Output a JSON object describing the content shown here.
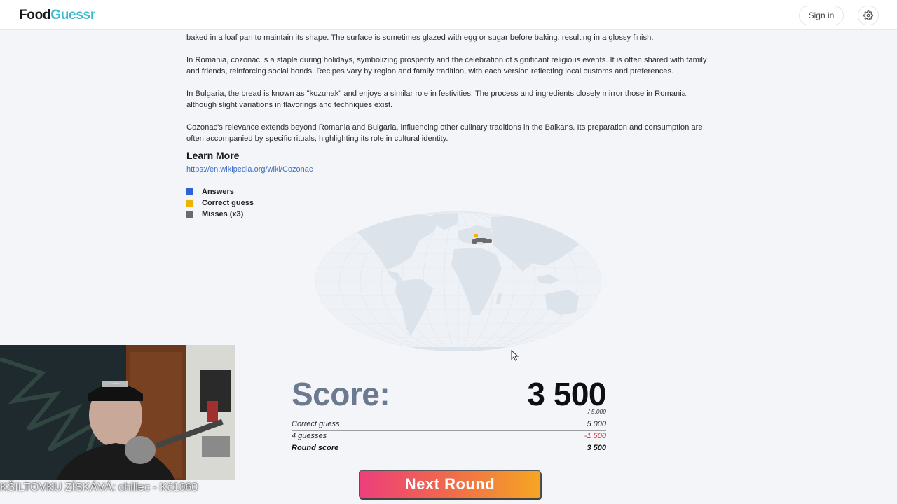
{
  "header": {
    "logo_part1": "Food",
    "logo_part2": "Guessr",
    "signin_label": "Sign in",
    "settings_icon": "gear-icon"
  },
  "article": {
    "paragraphs": [
      "baked in a loaf pan to maintain its shape. The surface is sometimes glazed with egg or sugar before baking, resulting in a glossy finish.",
      "In Romania, cozonac is a staple during holidays, symbolizing prosperity and the celebration of significant religious events. It is often shared with family and friends, reinforcing social bonds. Recipes vary by region and family tradition, with each version reflecting local customs and preferences.",
      "In Bulgaria, the bread is known as \"kozunak\" and enjoys a similar role in festivities. The process and ingredients closely mirror those in Romania, although slight variations in flavorings and techniques exist.",
      "Cozonac's relevance extends beyond Romania and Bulgaria, influencing other culinary traditions in the Balkans. Its preparation and consumption are often accompanied by specific rituals, highlighting its role in cultural identity."
    ],
    "learn_more_heading": "Learn More",
    "learn_more_link": "https://en.wikipedia.org/wiki/Cozonac"
  },
  "legend": {
    "items": [
      {
        "label": "Answers",
        "color": "#2f62d9"
      },
      {
        "label": "Correct guess",
        "color": "#f0b400"
      },
      {
        "label": "Misses (x3)",
        "color": "#6b6b6b"
      }
    ]
  },
  "map": {
    "land_color": "#dce3eb",
    "grid_color": "#e4e8ee",
    "correct_guess_color": "#f0b400",
    "miss_color": "#6b6b6b"
  },
  "score": {
    "label": "Score:",
    "value": "3 500",
    "max": "/ 5,000",
    "breakdown": [
      {
        "label": "Correct guess",
        "value": "5 000"
      },
      {
        "label": "4 guesses",
        "value": "-1 500"
      },
      {
        "label": "Round score",
        "value": "3 500"
      }
    ]
  },
  "next_round_label": "Next Round",
  "overlay": {
    "ticker_text": "KŠILTOVKU ZÍSKÁVÁ: chillec - Kč1060"
  }
}
